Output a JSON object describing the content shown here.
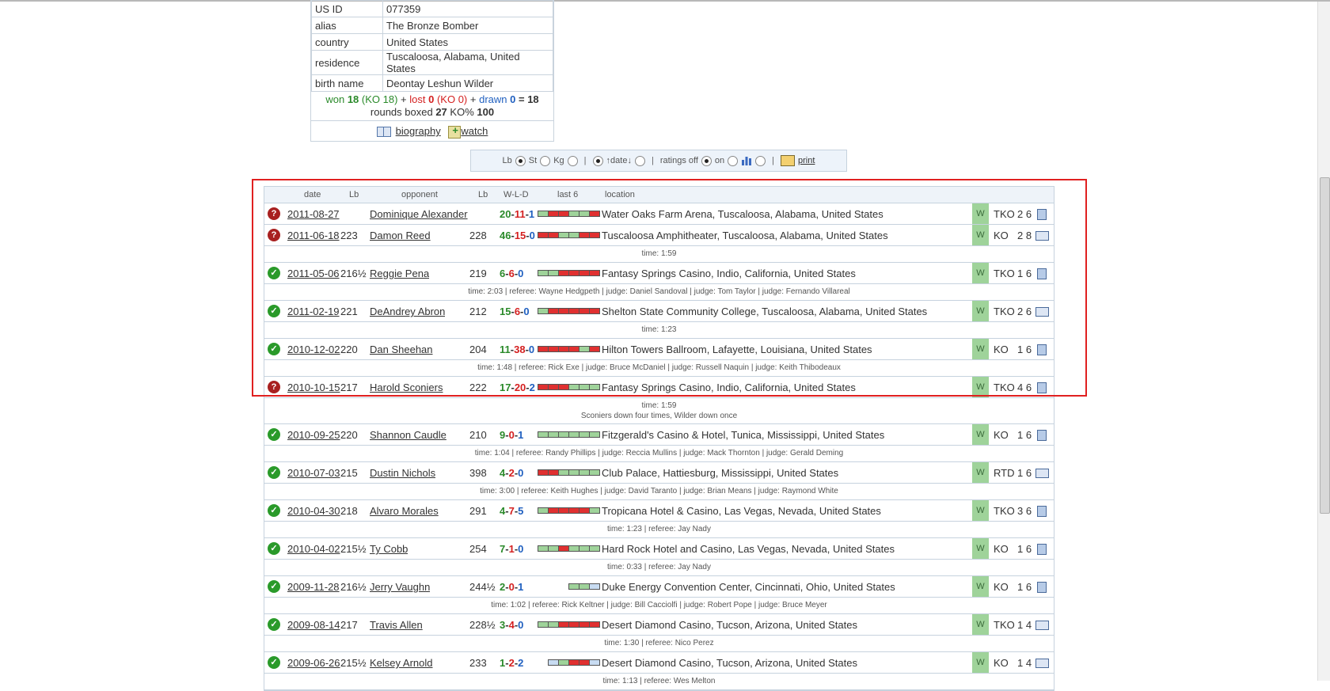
{
  "profile": {
    "rows": [
      {
        "label": "US ID",
        "value": "077359"
      },
      {
        "label": "alias",
        "value": "The Bronze Bomber"
      },
      {
        "label": "country",
        "value": "United States"
      },
      {
        "label": "residence",
        "value": "Tuscaloosa, Alabama, United States"
      },
      {
        "label": "birth name",
        "value": "Deontay Leshun Wilder"
      }
    ],
    "record": {
      "won_label": "won",
      "won": "18",
      "won_ko": "(KO 18)",
      "lost_label": "lost",
      "lost": "0",
      "lost_ko": "(KO 0)",
      "drawn_label": "drawn",
      "drawn": "0",
      "total": "= 18",
      "rounds_label": "rounds boxed",
      "rounds": "27",
      "ko_label": "KO%",
      "ko_pct": "100"
    },
    "links": {
      "biography": "biography",
      "watch": "watch"
    }
  },
  "options": {
    "lb": "Lb",
    "st": "St",
    "kg": "Kg",
    "date": "↑date↓",
    "ratings_off": "ratings off",
    "on": "on",
    "print": "print",
    "sep": "|"
  },
  "table_header": {
    "date": "date",
    "lb": "Lb",
    "opponent": "opponent",
    "olb": "Lb",
    "wld": "W-L-D",
    "last6": "last 6",
    "location": "location"
  },
  "colors": {
    "win": "#2a9a2a",
    "loss": "#e03030",
    "draw": "#2060c0",
    "highlight": "#e02020"
  },
  "fights": [
    {
      "status": "question",
      "date": "2011-08-27",
      "lb": "",
      "opponent": "Dominique Alexander",
      "olb": "",
      "w": "20",
      "l": "11",
      "d": "1",
      "last6": [
        "W",
        "L",
        "L",
        "W",
        "W",
        "L"
      ],
      "location": "Water Oaks Farm Arena, Tuscaloosa, Alabama, United States",
      "result": "W",
      "method": "TKO",
      "rounds": "2 6",
      "icon": "doc",
      "details": []
    },
    {
      "status": "question",
      "date": "2011-06-18",
      "lb": "223",
      "opponent": "Damon Reed",
      "olb": "228",
      "w": "46",
      "l": "15",
      "d": "0",
      "last6": [
        "L",
        "L",
        "W",
        "W",
        "L",
        "L"
      ],
      "location": "Tuscaloosa Amphitheater, Tuscaloosa, Alabama, United States",
      "result": "W",
      "method": "KO",
      "rounds": "2 8",
      "icon": "book",
      "details": [
        "time: 1:59"
      ]
    },
    {
      "status": "win",
      "date": "2011-05-06",
      "lb": "216½",
      "opponent": "Reggie Pena",
      "olb": "219",
      "w": "6",
      "l": "6",
      "d": "0",
      "last6": [
        "W",
        "W",
        "L",
        "L",
        "L",
        "L"
      ],
      "location": "Fantasy Springs Casino, Indio, California, United States",
      "result": "W",
      "method": "TKO",
      "rounds": "1 6",
      "icon": "doc",
      "details": [
        "time: 2:03 | referee: Wayne Hedgpeth | judge: Daniel Sandoval | judge: Tom Taylor | judge: Fernando Villareal"
      ]
    },
    {
      "status": "win",
      "date": "2011-02-19",
      "lb": "221",
      "opponent": "DeAndrey Abron",
      "olb": "212",
      "w": "15",
      "l": "6",
      "d": "0",
      "last6": [
        "W",
        "L",
        "L",
        "L",
        "L",
        "L"
      ],
      "location": "Shelton State Community College, Tuscaloosa, Alabama, United States",
      "result": "W",
      "method": "TKO",
      "rounds": "2 6",
      "icon": "book",
      "details": [
        "time: 1:23"
      ]
    },
    {
      "status": "win",
      "date": "2010-12-02",
      "lb": "220",
      "opponent": "Dan Sheehan",
      "olb": "204",
      "w": "11",
      "l": "38",
      "d": "0",
      "last6": [
        "L",
        "L",
        "L",
        "L",
        "W",
        "L"
      ],
      "location": "Hilton Towers Ballroom, Lafayette, Louisiana, United States",
      "result": "W",
      "method": "KO",
      "rounds": "1 6",
      "icon": "doc",
      "details": [
        "time: 1:48 | referee: Rick Exe | judge: Bruce McDaniel | judge: Russell Naquin | judge: Keith Thibodeaux"
      ]
    },
    {
      "status": "question",
      "date": "2010-10-15",
      "lb": "217",
      "opponent": "Harold Sconiers",
      "olb": "222",
      "w": "17",
      "l": "20",
      "d": "2",
      "last6": [
        "L",
        "L",
        "L",
        "W",
        "W",
        "W"
      ],
      "location": "Fantasy Springs Casino, Indio, California, United States",
      "result": "W",
      "method": "TKO",
      "rounds": "4 6",
      "icon": "doc",
      "details": [
        "time: 1:59",
        "Sconiers down four times, Wilder down once"
      ]
    },
    {
      "status": "win",
      "date": "2010-09-25",
      "lb": "220",
      "opponent": "Shannon Caudle",
      "olb": "210",
      "w": "9",
      "l": "0",
      "d": "1",
      "last6": [
        "W",
        "W",
        "W",
        "W",
        "W",
        "W"
      ],
      "location": "Fitzgerald's Casino & Hotel, Tunica, Mississippi, United States",
      "result": "W",
      "method": "KO",
      "rounds": "1 6",
      "icon": "doc",
      "details": [
        "time: 1:04 | referee: Randy Phillips | judge: Reccia Mullins | judge: Mack Thornton | judge: Gerald Deming"
      ]
    },
    {
      "status": "win",
      "date": "2010-07-03",
      "lb": "215",
      "opponent": "Dustin Nichols",
      "olb": "398",
      "w": "4",
      "l": "2",
      "d": "0",
      "last6": [
        "L",
        "L",
        "W",
        "W",
        "W",
        "W"
      ],
      "location": "Club Palace, Hattiesburg, Mississippi, United States",
      "result": "W",
      "method": "RTD",
      "rounds": "1 6",
      "icon": "book",
      "details": [
        "time: 3:00 | referee: Keith Hughes | judge: David Taranto | judge: Brian Means | judge: Raymond White"
      ]
    },
    {
      "status": "win",
      "date": "2010-04-30",
      "lb": "218",
      "opponent": "Alvaro Morales",
      "olb": "291",
      "w": "4",
      "l": "7",
      "d": "5",
      "last6": [
        "W",
        "L",
        "L",
        "L",
        "L",
        "W"
      ],
      "location": "Tropicana Hotel & Casino, Las Vegas, Nevada, United States",
      "result": "W",
      "method": "TKO",
      "rounds": "3 6",
      "icon": "doc",
      "details": [
        "time: 1:23 | referee: Jay Nady"
      ]
    },
    {
      "status": "win",
      "date": "2010-04-02",
      "lb": "215½",
      "opponent": "Ty Cobb",
      "olb": "254",
      "w": "7",
      "l": "1",
      "d": "0",
      "last6": [
        "W",
        "W",
        "L",
        "W",
        "W",
        "W"
      ],
      "location": "Hard Rock Hotel and Casino, Las Vegas, Nevada, United States",
      "result": "W",
      "method": "KO",
      "rounds": "1 6",
      "icon": "doc",
      "details": [
        "time: 0:33 | referee: Jay Nady"
      ]
    },
    {
      "status": "win",
      "date": "2009-11-28",
      "lb": "216½",
      "opponent": "Jerry Vaughn",
      "olb": "244½",
      "w": "2",
      "l": "0",
      "d": "1",
      "last6": [
        "W",
        "W",
        "D"
      ],
      "location": "Duke Energy Convention Center, Cincinnati, Ohio, United States",
      "result": "W",
      "method": "KO",
      "rounds": "1 6",
      "icon": "doc",
      "details": [
        "time: 1:02 | referee: Rick Keltner | judge: Bill Cacciolfi | judge: Robert Pope | judge: Bruce Meyer"
      ]
    },
    {
      "status": "win",
      "date": "2009-08-14",
      "lb": "217",
      "opponent": "Travis Allen",
      "olb": "228½",
      "w": "3",
      "l": "4",
      "d": "0",
      "last6": [
        "W",
        "W",
        "L",
        "L",
        "L",
        "L"
      ],
      "location": "Desert Diamond Casino, Tucson, Arizona, United States",
      "result": "W",
      "method": "TKO",
      "rounds": "1 4",
      "icon": "book",
      "details": [
        "time: 1:30 | referee: Nico Perez"
      ]
    },
    {
      "status": "win",
      "date": "2009-06-26",
      "lb": "215½",
      "opponent": "Kelsey Arnold",
      "olb": "233",
      "w": "1",
      "l": "2",
      "d": "2",
      "last6": [
        "D",
        "W",
        "L",
        "L",
        "D"
      ],
      "location": "Desert Diamond Casino, Tucson, Arizona, United States",
      "result": "W",
      "method": "KO",
      "rounds": "1 4",
      "icon": "book",
      "details": [
        "time: 1:13 | referee: Wes Melton"
      ]
    }
  ]
}
